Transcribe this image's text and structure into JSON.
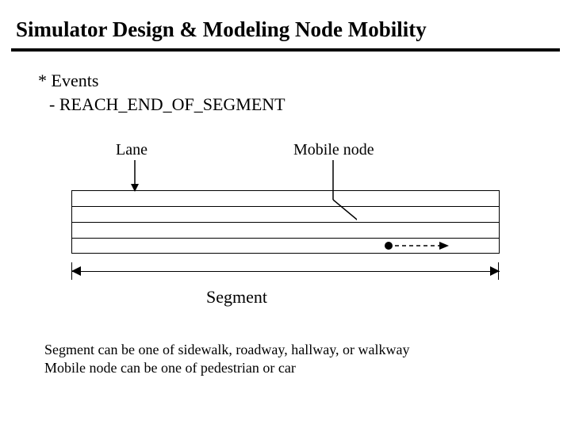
{
  "title": "Simulator Design & Modeling Node Mobility",
  "bullets": {
    "l1": "* Events",
    "l2": "- REACH_END_OF_SEGMENT"
  },
  "labels": {
    "lane": "Lane",
    "mobile_node": "Mobile node",
    "segment": "Segment"
  },
  "footer": {
    "l1": "Segment can be one of sidewalk, roadway, hallway, or walkway",
    "l2": "Mobile node can be one of pedestrian or car"
  }
}
